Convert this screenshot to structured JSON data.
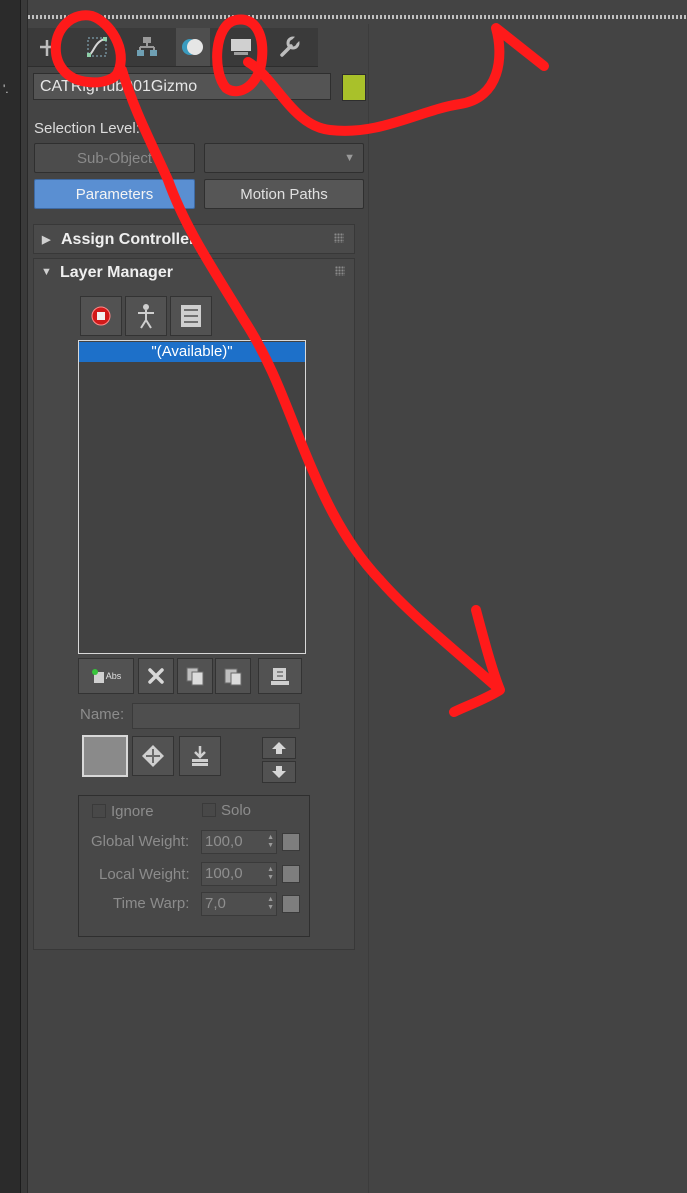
{
  "tabs": [
    {
      "name": "create-icon",
      "glyph": "+",
      "active": false
    },
    {
      "name": "modify-icon",
      "glyph": "curve",
      "active": false
    },
    {
      "name": "hierarchy-icon",
      "glyph": "tree",
      "active": false
    },
    {
      "name": "motion-icon",
      "glyph": "motion",
      "active": true
    },
    {
      "name": "display-icon",
      "glyph": "monitor",
      "active": false
    },
    {
      "name": "utilities-icon",
      "glyph": "wrench",
      "active": false
    }
  ],
  "object_name": "CATRigHub001Gizmo",
  "object_color": "#a9c12a",
  "selection_level": {
    "label": "Selection Level:",
    "sub_object": "Sub-Object",
    "dropdown_value": ""
  },
  "mode_buttons": {
    "parameters": "Parameters",
    "motion_paths": "Motion Paths"
  },
  "rollouts": {
    "assign_controller": "Assign Controller",
    "layer_manager": "Layer Manager"
  },
  "layer_list": {
    "items": [
      "\"(Available)\""
    ]
  },
  "abs_label": "Abs",
  "name_label": "Name:",
  "name_value": "",
  "weights": {
    "ignore": "Ignore",
    "solo": "Solo",
    "global_weight_label": "Global Weight:",
    "global_weight_value": "100,0",
    "local_weight_label": "Local Weight:",
    "local_weight_value": "100,0",
    "time_warp_label": "Time Warp:",
    "time_warp_value": "7,0"
  },
  "left_dots": "'.",
  "annotation_color": "#ff1a1a"
}
